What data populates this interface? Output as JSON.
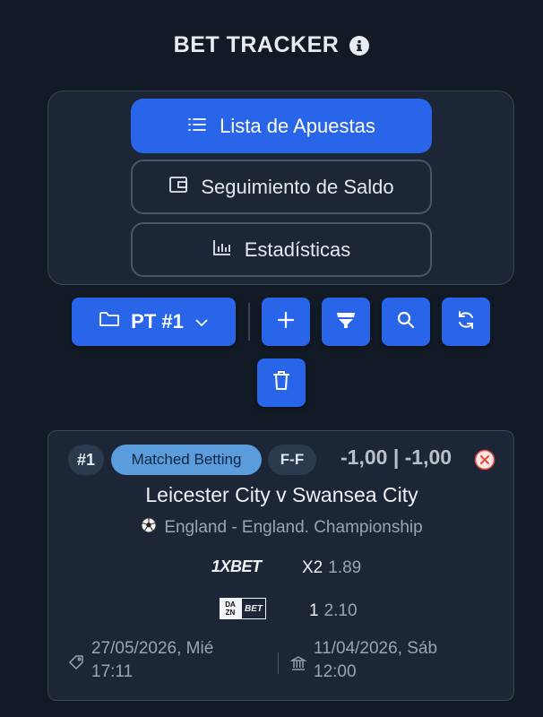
{
  "header": {
    "title": "BET TRACKER",
    "info_icon": "info-icon"
  },
  "nav": {
    "items": [
      {
        "label": "Lista de Apuestas",
        "icon": "list-icon",
        "active": true
      },
      {
        "label": "Seguimiento de Saldo",
        "icon": "wallet-icon",
        "active": false
      },
      {
        "label": "Estadísticas",
        "icon": "bar-chart-icon",
        "active": false
      }
    ]
  },
  "toolbar": {
    "portfolio_label": "PT #1",
    "buttons": [
      "plus-icon",
      "filter-icon",
      "search-icon",
      "refresh-icon",
      "trash-icon"
    ]
  },
  "bet": {
    "number": "#1",
    "type": "Matched Betting",
    "code": "F-F",
    "result": "-1,00 | -1,00",
    "match": "Leicester City v Swansea City",
    "league": "England - England. Championship",
    "legs": [
      {
        "bookmaker": "1XBET",
        "selection": "X2",
        "odds": "1.89"
      },
      {
        "bookmaker": "DAZN BET",
        "selection": "1",
        "odds": "2.10"
      }
    ],
    "created": {
      "line1": "27/05/2026, Mié",
      "line2": "17:11"
    },
    "event_date": {
      "line1": "11/04/2026, Sáb",
      "line2": "12:00"
    }
  },
  "colors": {
    "accent": "#2965e8",
    "background": "#121a25",
    "panel": "#1c2636",
    "badge_blue": "#5b9ddc",
    "error": "#e74c3c"
  }
}
